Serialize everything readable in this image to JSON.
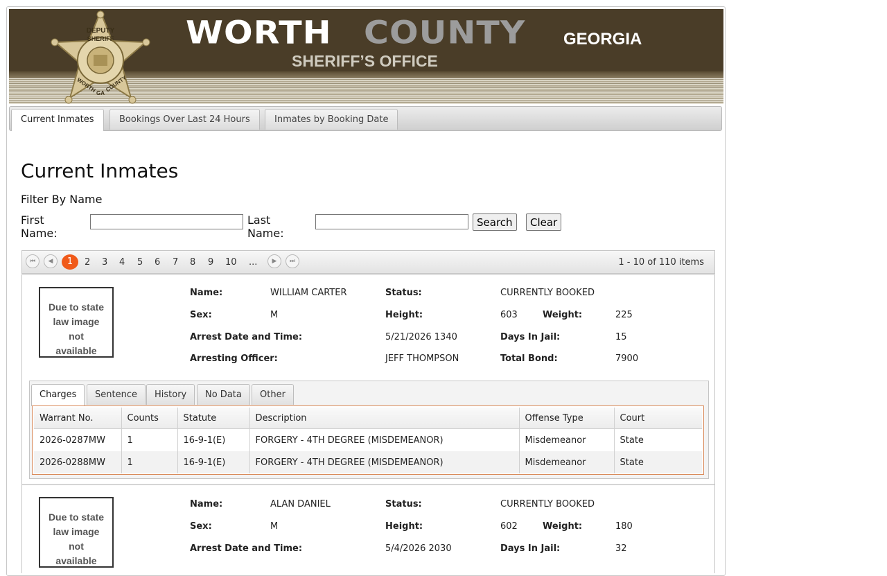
{
  "banner": {
    "title_worth": "WORTH",
    "title_county": "COUNTY",
    "title_state": "GEORGIA",
    "subtitle": "SHERIFF’S OFFICE",
    "badge": {
      "top": "DEPUTY",
      "mid": "SHERIFF",
      "left": "WORTH",
      "center": "GA",
      "right": "COUNTY"
    }
  },
  "nav": {
    "tabs": [
      {
        "label": "Current Inmates"
      },
      {
        "label": "Bookings Over Last 24 Hours"
      },
      {
        "label": "Inmates by Booking Date"
      }
    ]
  },
  "main": {
    "title": "Current Inmates",
    "filter_label": "Filter By Name",
    "first_name_label": "First Name:",
    "last_name_label": "Last Name:",
    "first_name_value": "",
    "last_name_value": "",
    "search_label": "Search",
    "clear_label": "Clear"
  },
  "pager": {
    "current": "1",
    "pages": [
      "2",
      "3",
      "4",
      "5",
      "6",
      "7",
      "8",
      "9",
      "10",
      "..."
    ],
    "info": "1 - 10 of 110 items"
  },
  "labels": {
    "name": "Name:",
    "status": "Status:",
    "sex": "Sex:",
    "height": "Height:",
    "weight": "Weight:",
    "arrest": "Arrest Date and Time:",
    "days": "Days In Jail:",
    "officer": "Arresting Officer:",
    "bond": "Total Bond:"
  },
  "photo_notice": [
    "Due to state",
    "law image not",
    "available"
  ],
  "subtabs": [
    "Charges",
    "Sentence",
    "History",
    "No Data",
    "Other"
  ],
  "charge_headers": [
    "Warrant No.",
    "Counts",
    "Statute",
    "Description",
    "Offense Type",
    "Court"
  ],
  "inmates": [
    {
      "name": "WILLIAM CARTER",
      "status": "CURRENTLY BOOKED",
      "sex": "M",
      "height": "603",
      "weight": "225",
      "arrest": "5/21/2026 1340",
      "days": "15",
      "officer": "JEFF THOMPSON",
      "bond": "7900",
      "charges": [
        [
          "2026-0287MW",
          "1",
          "16-9-1(E)",
          "FORGERY - 4TH DEGREE (MISDEMEANOR)",
          "Misdemeanor",
          "State"
        ],
        [
          "2026-0288MW",
          "1",
          "16-9-1(E)",
          "FORGERY - 4TH DEGREE (MISDEMEANOR)",
          "Misdemeanor",
          "State"
        ]
      ]
    },
    {
      "name": "ALAN DANIEL",
      "status": "CURRENTLY BOOKED",
      "sex": "M",
      "height": "602",
      "weight": "180",
      "arrest": "5/4/2026 2030",
      "days": "32"
    }
  ]
}
